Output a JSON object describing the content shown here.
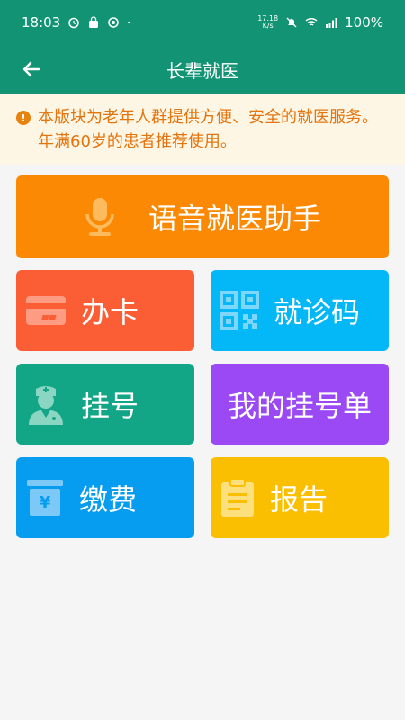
{
  "status_bar": {
    "time": "18:03",
    "speed_value": "17.18",
    "speed_unit": "K/s",
    "battery": "100%",
    "icons": [
      "alarm-icon",
      "shopping-bag-icon",
      "sync-icon",
      "dot-icon",
      "mute-icon",
      "wifi-icon",
      "signal-icon"
    ]
  },
  "header": {
    "title": "长辈就医",
    "back_icon": "arrow-left-icon"
  },
  "notice": {
    "icon": "alert-circle-icon",
    "text": "本版块为老年人群提供方便、安全的就医服务。年满60岁的患者推荐使用。"
  },
  "tiles": {
    "voice": {
      "label": "语音就医助手",
      "icon": "microphone-icon",
      "color": "#fb8904"
    },
    "card": {
      "label": "办卡",
      "icon": "card-icon",
      "color": "#fb5e35"
    },
    "code": {
      "label": "就诊码",
      "icon": "qr-code-icon",
      "color": "#04b7f6"
    },
    "register": {
      "label": "挂号",
      "icon": "doctor-icon",
      "color": "#12a686"
    },
    "my_orders": {
      "label": "我的挂号单",
      "color": "#9a49f4"
    },
    "pay": {
      "label": "缴费",
      "icon": "yen-wallet-icon",
      "color": "#069cf0"
    },
    "report": {
      "label": "报告",
      "icon": "clipboard-icon",
      "color": "#fbbf02"
    }
  },
  "colors": {
    "primary": "#129474",
    "notice_bg": "#fdf6e5",
    "notice_text": "#e4740d",
    "page_bg": "#f5f5f5"
  }
}
